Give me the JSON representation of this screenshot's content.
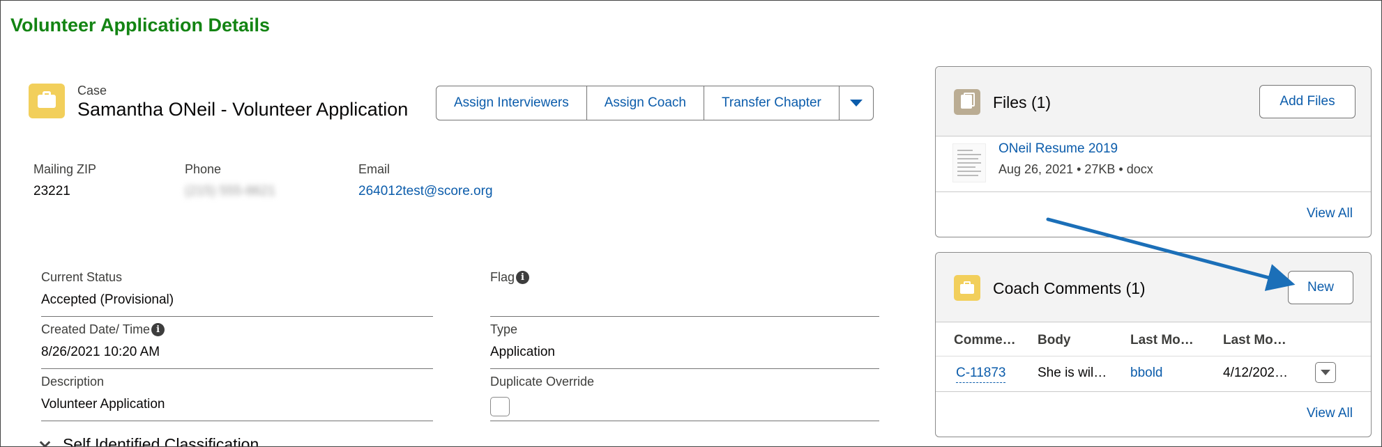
{
  "page": {
    "title": "Volunteer Application Details"
  },
  "record": {
    "object_label": "Case",
    "name": "Samantha ONeil - Volunteer Application",
    "icon": "case-briefcase-icon",
    "actions": [
      "Assign Interviewers",
      "Assign Coach",
      "Transfer Chapter"
    ]
  },
  "highlights": {
    "zip_label": "Mailing ZIP",
    "zip_value": "23221",
    "phone_label": "Phone",
    "phone_value": "(215) 555-8621",
    "email_label": "Email",
    "email_value": "264012test@score.org"
  },
  "details": {
    "status_label": "Current Status",
    "status_value": "Accepted (Provisional)",
    "flag_label": "Flag",
    "flag_value": "",
    "created_label": "Created Date/ Time",
    "created_value": "8/26/2021 10:20 AM",
    "type_label": "Type",
    "type_value": "Application",
    "description_label": "Description",
    "description_value": "Volunteer Application",
    "duplicate_label": "Duplicate Override",
    "duplicate_checked": false
  },
  "section": {
    "title": "Self Identified Classification"
  },
  "files_card": {
    "title": "Files (1)",
    "add_label": "Add Files",
    "file_name": "ONeil Resume 2019",
    "file_meta": "Aug 26, 2021  •  27KB  •  docx",
    "view_all": "View All"
  },
  "comments_card": {
    "title": "Coach Comments (1)",
    "new_label": "New",
    "columns": [
      "Comme…",
      "Body",
      "Last Mo…",
      "Last Mo…"
    ],
    "row": {
      "id": "C-11873",
      "body": "She is wil…",
      "modified_by": "bbold",
      "modified_date": "4/12/202…"
    },
    "view_all": "View All"
  },
  "colors": {
    "title_green": "#138413",
    "link_blue": "#0b5cab",
    "case_icon_yellow": "#f2cf5b",
    "files_icon_tan": "#baac93",
    "annotation_arrow": "#1b6fb8"
  }
}
